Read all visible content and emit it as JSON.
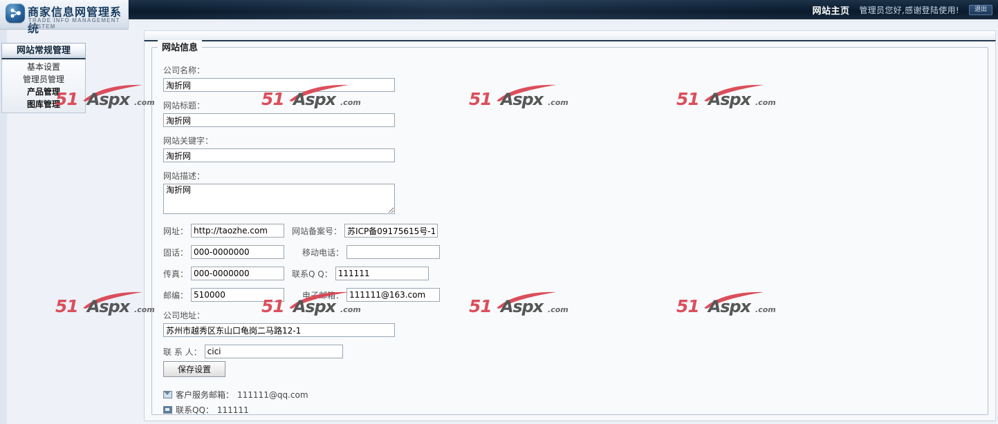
{
  "header": {
    "brand_cn": "商家信息网管理系统",
    "brand_en": "TRADE INFO MANAGEMENT SYSTEM",
    "home_link": "网站主页",
    "greeting": "管理员您好,感谢登陆使用!",
    "exit_label": "退出",
    "logo_icon": "network-node-icon"
  },
  "sidebar": {
    "title": "网站常规管理",
    "items": [
      {
        "label": "基本设置",
        "bold": false
      },
      {
        "label": "管理员管理",
        "bold": false
      },
      {
        "label": "产品管理",
        "bold": true
      },
      {
        "label": "图库管理",
        "bold": true
      }
    ]
  },
  "panel": {
    "legend": "网站信息"
  },
  "form": {
    "company_name": {
      "label": "公司名称：",
      "value": "淘折网"
    },
    "site_title": {
      "label": "网站标题：",
      "value": "淘折网"
    },
    "site_keywords": {
      "label": "网站关键字：",
      "value": "淘折网"
    },
    "site_description": {
      "label": "网站描述：",
      "value": "淘折网"
    },
    "url": {
      "label": "网址：",
      "value": "http://taozhe.com"
    },
    "icp": {
      "label": "网站备案号：",
      "value": "苏ICP备09175615号-1"
    },
    "tel": {
      "label": "固话：",
      "value": "000-0000000"
    },
    "mobile": {
      "label": "移动电话：",
      "value": ""
    },
    "fax": {
      "label": "传真：",
      "value": "000-0000000"
    },
    "qq": {
      "label": "联系Q  Q：",
      "value": "111111"
    },
    "zipcode": {
      "label": "邮编：",
      "value": "510000"
    },
    "email": {
      "label": "电子邮箱：",
      "value": "111111@163.com"
    },
    "address": {
      "label": "公司地址：",
      "value": "苏州市越秀区东山口龟岗二马路12-1"
    },
    "contact_person": {
      "label": "联 系 人：",
      "value": "cici"
    },
    "save_button": "保存设置"
  },
  "footer_contacts": [
    {
      "icon": "mail-icon",
      "label": "客户服务邮箱：",
      "value": "111111@qq.com"
    },
    {
      "icon": "qq-icon",
      "label": "联系QQ：",
      "value": "111111"
    }
  ],
  "watermark": {
    "part1": "51",
    "part2": "Aspx",
    "part3": ".com",
    "color_red": "#d9414e",
    "color_dark": "#4a4a4a"
  },
  "colors": {
    "header_dark": "#10243a",
    "panel_border": "#b6c0cd",
    "page_bg": "#eef1f8",
    "content_bg": "#f7f9fb"
  }
}
